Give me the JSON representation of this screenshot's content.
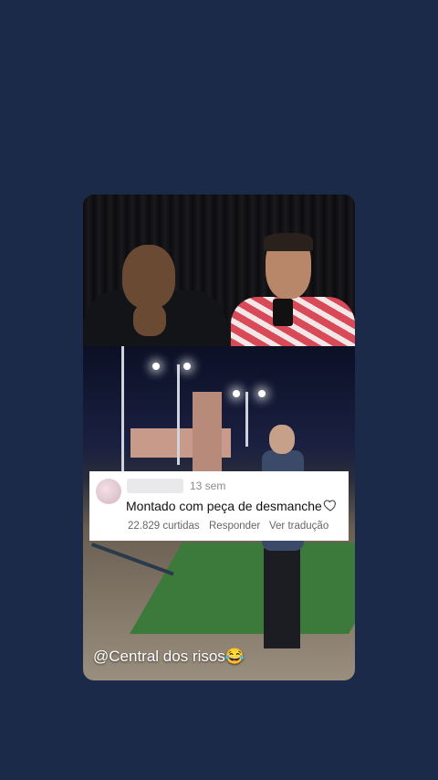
{
  "comment": {
    "age": "13 sem",
    "text": "Montado com peça de desmanche",
    "likes": "22.829 curtidas",
    "reply_label": "Responder",
    "translate_label": "Ver tradução"
  },
  "video": {
    "watermark": "@Central dos risos😂"
  },
  "icons": {
    "like": "heart-outline-icon"
  },
  "colors": {
    "background": "#1c2a4a",
    "comment_bg": "#ffffff"
  }
}
